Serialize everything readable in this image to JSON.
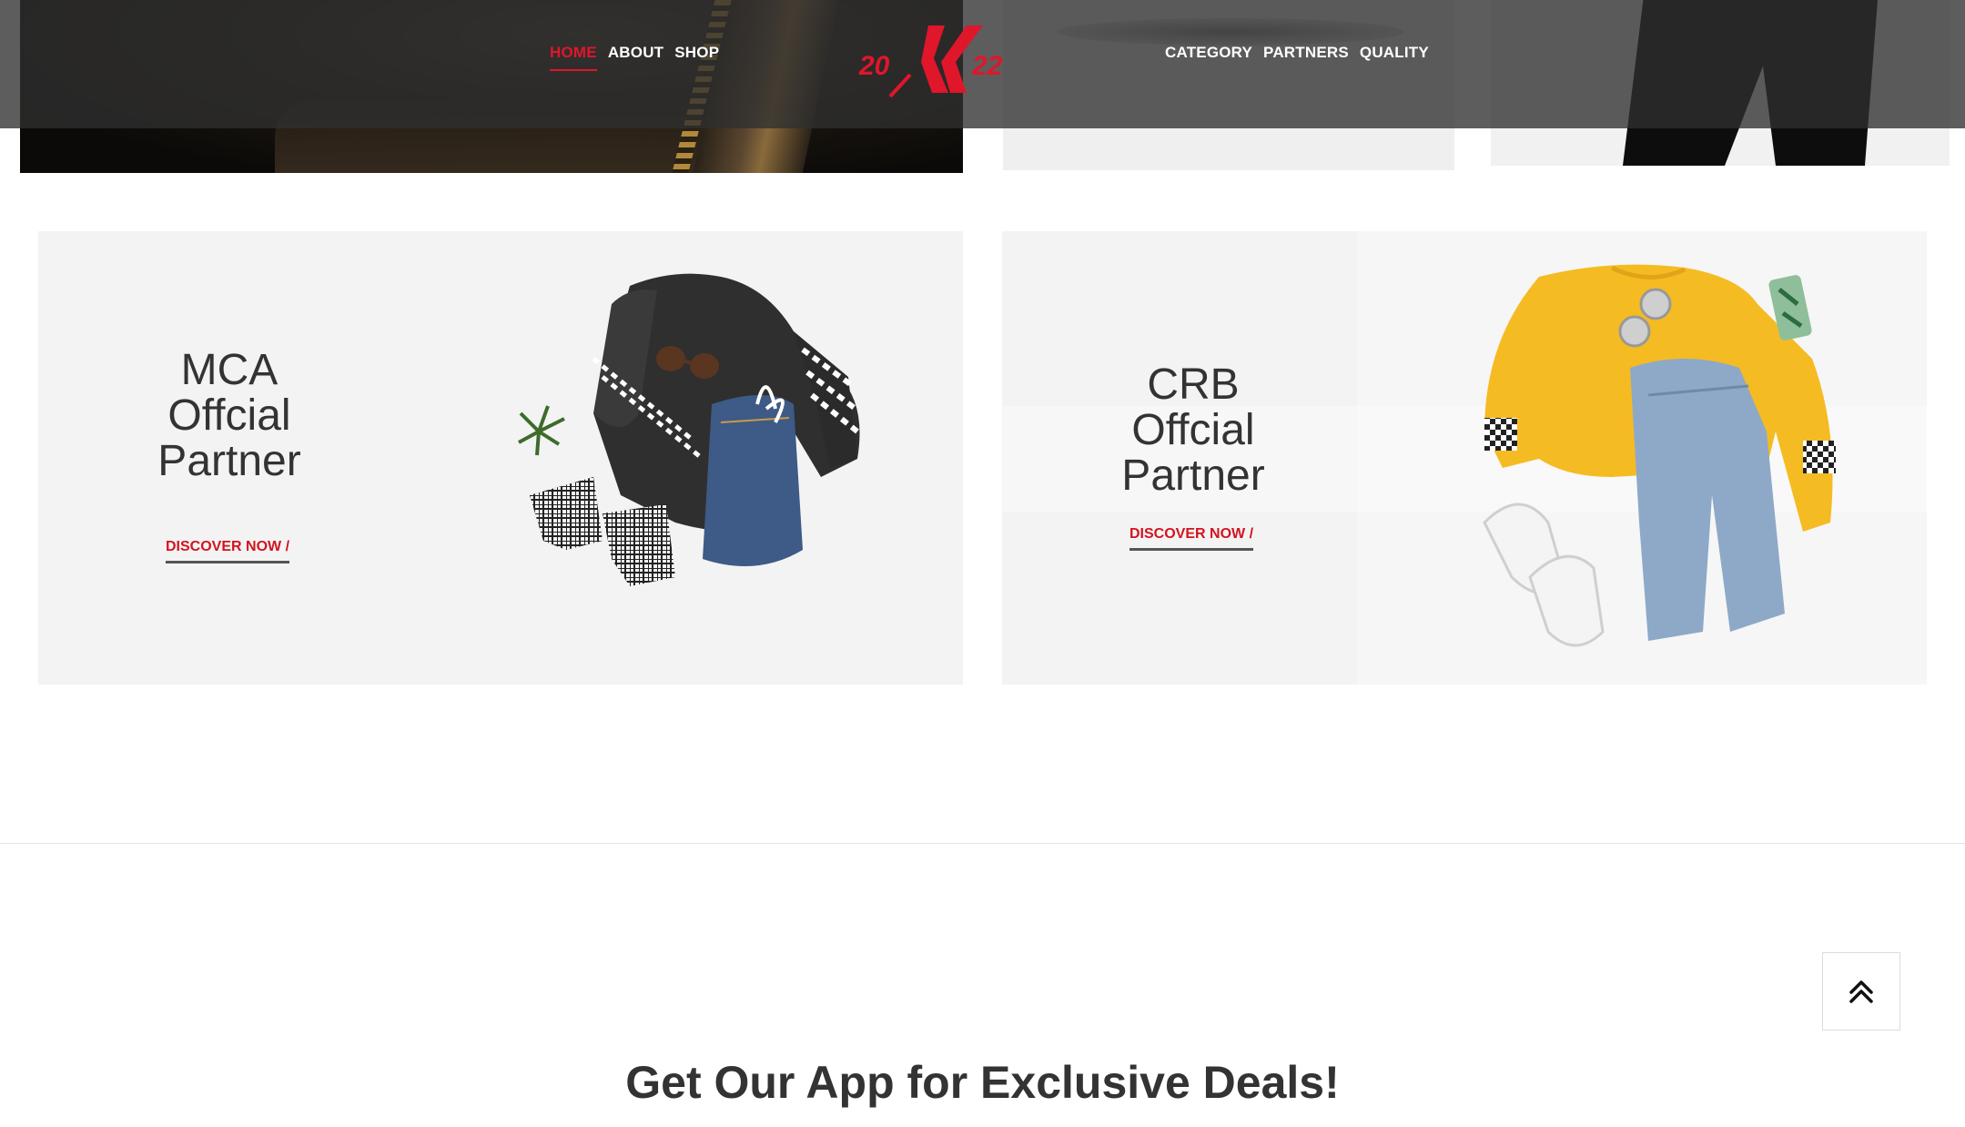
{
  "header": {
    "nav_left": [
      {
        "label": "HOME",
        "active": true
      },
      {
        "label": "ABOUT",
        "active": false
      },
      {
        "label": "SHOP",
        "active": false
      }
    ],
    "nav_right": [
      {
        "label": "CATEGORY"
      },
      {
        "label": "PARTNERS"
      },
      {
        "label": "QUALITY"
      }
    ],
    "logo": {
      "text_left": "20",
      "text_right": "22",
      "color": "#e0162b"
    }
  },
  "partners": [
    {
      "line1": "MCA",
      "line2": "Offcial",
      "line3": "Partner",
      "cta": "DISCOVER NOW /"
    },
    {
      "line1": "CRB",
      "line2": "Offcial",
      "line3": "Partner",
      "cta": "DISCOVER NOW /"
    }
  ],
  "app_section": {
    "heading": "Get Our App for Exclusive Deals!"
  },
  "colors": {
    "accent": "#e0162b",
    "cta": "#d3141f",
    "text": "#333333",
    "card_bg": "#f3f3f3"
  },
  "icons": {
    "back_to_top": "double-chevron-up-icon"
  }
}
